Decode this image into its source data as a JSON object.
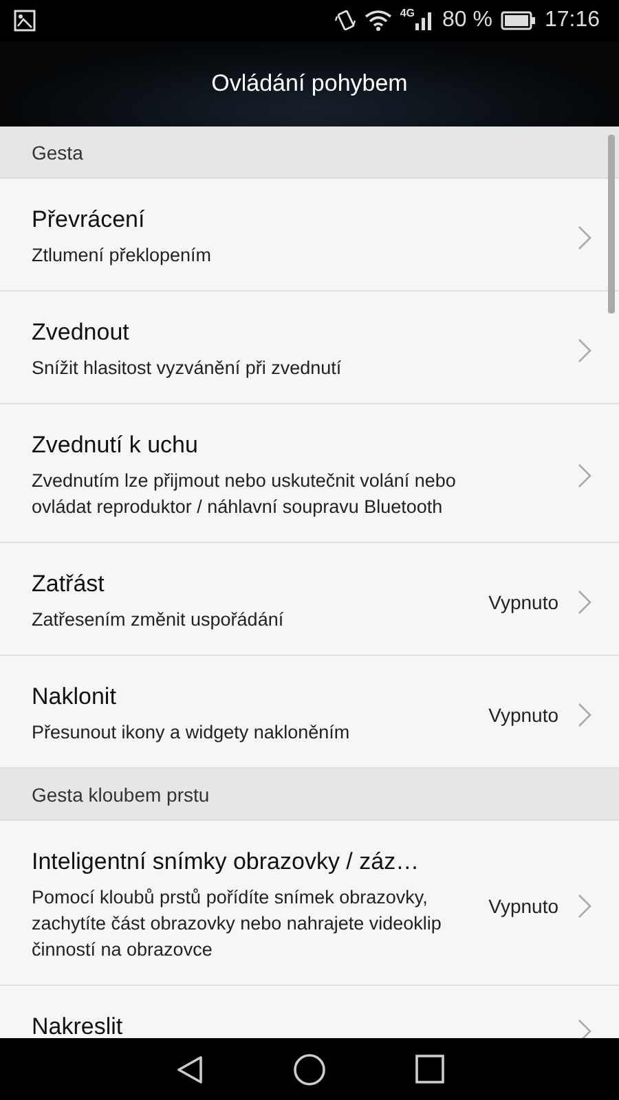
{
  "status_bar": {
    "network": "4G",
    "battery": "80 %",
    "time": "17:16"
  },
  "title": "Ovládání pohybem",
  "sections": [
    {
      "header": "Gesta",
      "items": [
        {
          "title": "Převrácení",
          "subtitle": "Ztlumení překlopením"
        },
        {
          "title": "Zvednout",
          "subtitle": "Snížit hlasitost vyzvánění při zvednutí"
        },
        {
          "title": "Zvednutí k uchu",
          "subtitle": "Zvednutím lze přijmout nebo uskutečnit volání nebo ovládat reproduktor / náhlavní soupravu Bluetooth"
        },
        {
          "title": "Zatřást",
          "subtitle": "Zatřesením změnit uspořádání",
          "value": "Vypnuto"
        },
        {
          "title": "Naklonit",
          "subtitle": "Přesunout ikony a widgety nakloněním",
          "value": "Vypnuto"
        }
      ]
    },
    {
      "header": "Gesta kloubem prstu",
      "items": [
        {
          "title": "Inteligentní snímky obrazovky / záz…",
          "subtitle": "Pomocí kloubů prstů pořídíte snímek obrazovky, zachytíte část obrazovky nebo nahrajete videoklip činností na obrazovce",
          "value": "Vypnuto"
        },
        {
          "title": "Nakreslit"
        }
      ]
    }
  ]
}
